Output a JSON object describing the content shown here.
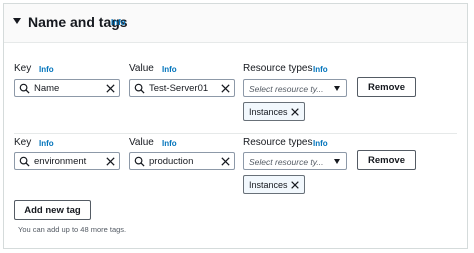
{
  "section": {
    "title": "Name and tags",
    "info": "Info"
  },
  "tag_rows": [
    {
      "key_label": "Key",
      "key_info": "Info",
      "key_value": "Name",
      "value_label": "Value",
      "value_info": "Info",
      "value_value": "Test-Server01",
      "resource_label": "Resource types",
      "resource_info": "Info",
      "resource_placeholder": "Select resource ty...",
      "remove_label": "Remove",
      "token_label": "Instances"
    },
    {
      "key_label": "Key",
      "key_info": "Info",
      "key_value": "environment",
      "value_label": "Value",
      "value_info": "Info",
      "value_value": "production",
      "resource_label": "Resource types",
      "resource_info": "Info",
      "resource_placeholder": "Select resource ty...",
      "remove_label": "Remove",
      "token_label": "Instances"
    }
  ],
  "add_tag": {
    "label": "Add new tag",
    "hint": "You can add up to 48 more tags."
  },
  "icons": [
    "caret-down-icon",
    "search-icon",
    "clear-icon",
    "dropdown-caret-icon",
    "token-dismiss-icon"
  ],
  "colors": {
    "info_link": "#0073bb",
    "border": "#8d99a8",
    "token_bg": "#f2f8fd"
  }
}
